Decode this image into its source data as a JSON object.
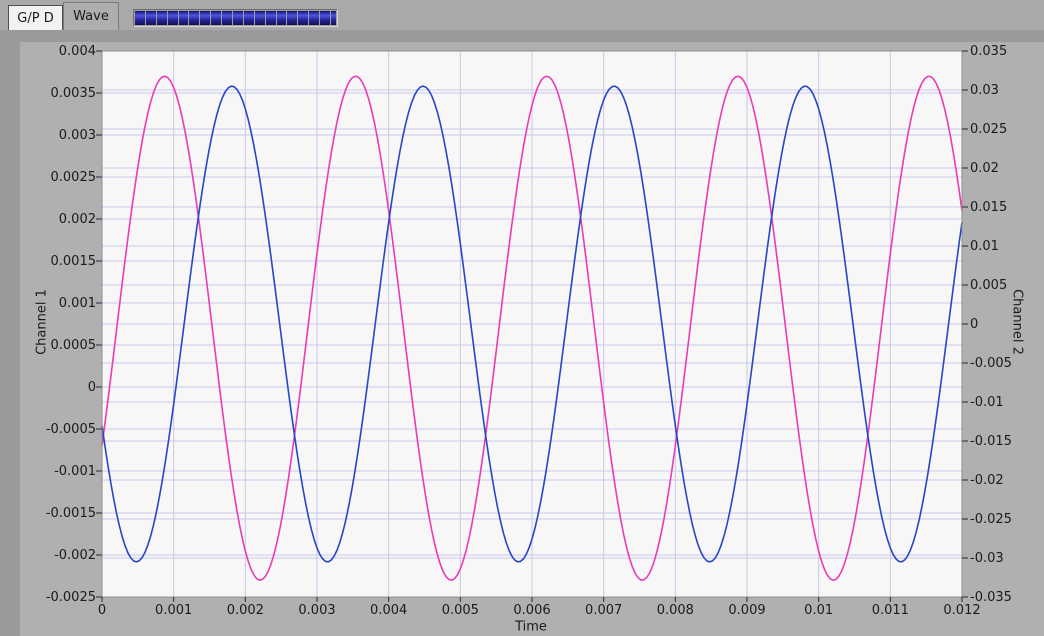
{
  "tabs": [
    {
      "label": "G/P D",
      "active": false
    },
    {
      "label": "Wave",
      "active": true
    }
  ],
  "progress": {
    "segment_count": 18,
    "has_partial_end_segment": true,
    "fill_percent": 100
  },
  "colors": {
    "page_bg": "#aeaeae",
    "tabbar_bg": "#a9a9a9",
    "shadow": "#9a9a9a",
    "graph_bg": "#b0b0b0",
    "plot_bg": "#f7f7f7",
    "plot_border": "#8f8f8f",
    "grid": "#c8c8e8",
    "tick": "#2a2a2a",
    "text": "#1b1b1b",
    "tab_inactive_bg": "#f2f2f2",
    "tab_border": "#4f4f4f",
    "active_tab_border": "#7a7a7a",
    "channel1": "#ea3cb4",
    "channel2": "#2746c6",
    "progress_gap": "#9e9e9e",
    "progress_border": "#6f6f6f",
    "progress_segment_top": "#12125e",
    "progress_segment_bright": "#5353dc",
    "progress_segment_bottom": "#10104e"
  },
  "chart_data": {
    "type": "line",
    "title": "",
    "xlabel": "Time",
    "xlim": [
      0,
      0.012
    ],
    "x_tick_labels": [
      "0",
      "0.001",
      "0.002",
      "0.003",
      "0.004",
      "0.005",
      "0.006",
      "0.007",
      "0.008",
      "0.009",
      "0.01",
      "0.011",
      "0.012"
    ],
    "left_axis": {
      "label": "Channel 1",
      "min": -0.0025,
      "max": 0.004,
      "tick_labels": [
        "0.004",
        "0.0035",
        "0.003",
        "0.0025",
        "0.002",
        "0.0015",
        "0.001",
        "0.0005",
        "0",
        "-0.0005",
        "-0.001",
        "-0.0015",
        "-0.002",
        "-0.0025"
      ]
    },
    "right_axis": {
      "label": "Channel 2",
      "min": -0.035,
      "max": 0.035,
      "tick_labels": [
        "0.035",
        "0.03",
        "0.025",
        "0.02",
        "0.015",
        "0.01",
        "0.005",
        "0",
        "-0.005",
        "-0.01",
        "-0.015",
        "-0.02",
        "-0.025",
        "-0.03",
        "-0.035"
      ]
    },
    "grid": true,
    "legend": "none",
    "series": [
      {
        "name": "Channel 1",
        "axis": "left",
        "color": "#ea3cb4",
        "waveform": "sine",
        "frequency_hz": 375,
        "amplitude": 0.003,
        "dc_offset": 0.0007,
        "phase_rad": -0.485,
        "approx_peak": 0.0037,
        "approx_trough": -0.0023,
        "samples": 300
      },
      {
        "name": "Channel 2",
        "axis": "right",
        "color": "#2746c6",
        "waveform": "sine",
        "frequency_hz": 375,
        "amplitude": 0.0305,
        "dc_offset": 0,
        "phase_rad": -2.7,
        "approx_peak": 0.0305,
        "approx_trough": -0.0305,
        "samples": 300
      }
    ]
  }
}
